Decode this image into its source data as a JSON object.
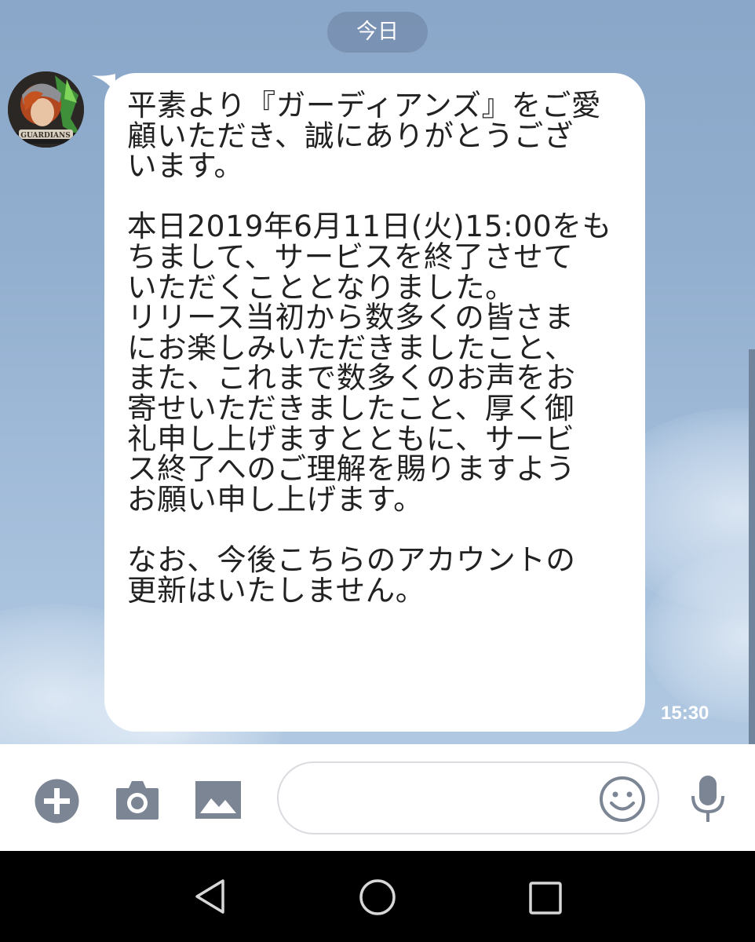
{
  "header": {
    "date_label": "今日"
  },
  "message": {
    "sender_avatar": "guardians-logo-avatar",
    "text": "平素より『ガーディアンズ』をご愛\n顧いただき、誠にありがとうござ\nいます。\n\n本日2019年6月11日(火)15:00をも\nちまして、サービスを終了させて\nいただくこととなりました。\nリリース当初から数多くの皆さま\nにお楽しみいただきましたこと、\nまた、これまで数多くのお声をお\n寄せいただきましたこと、厚く御\n礼申し上げますとともに、サービ\nス終了へのご理解を賜りますよう\nお願い申し上げます。\n\nなお、今後こちらのアカウントの\n更新はいたしません。",
    "time": "15:30"
  },
  "input_bar": {
    "message_input_value": "",
    "icons": [
      "plus-icon",
      "camera-icon",
      "image-icon",
      "emoji-icon",
      "microphone-icon"
    ]
  },
  "nav_bar": {
    "icons": [
      "back-icon",
      "home-icon",
      "recents-icon"
    ]
  },
  "colors": {
    "chat_background": "#93afcf",
    "bubble": "#ffffff",
    "icon_gray": "#7b8594",
    "nav_background": "#000000"
  }
}
